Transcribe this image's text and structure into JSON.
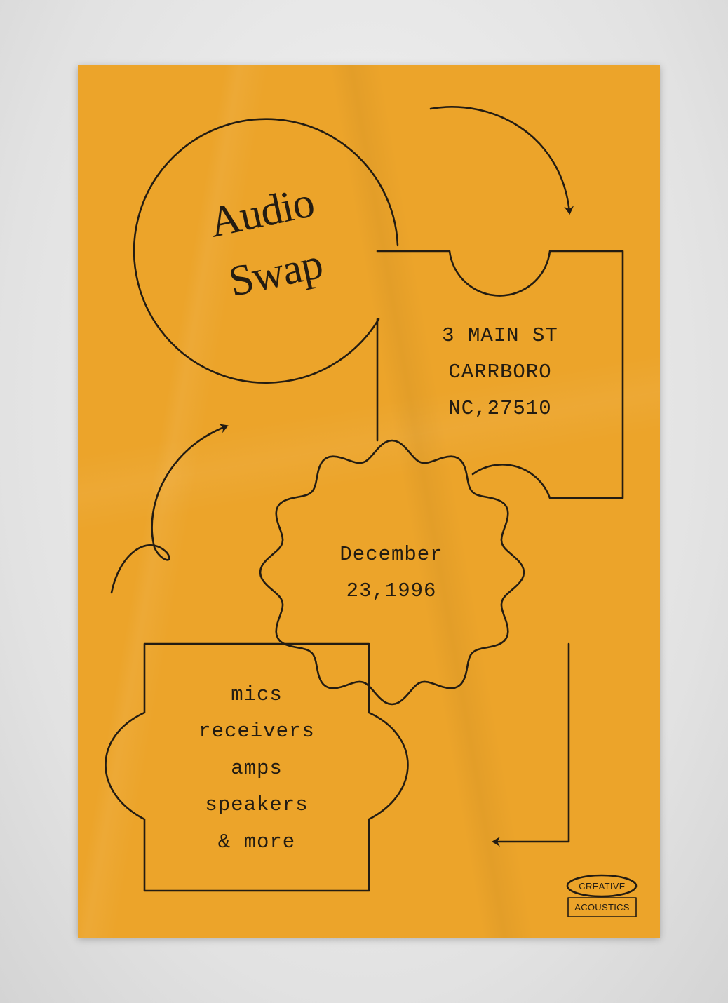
{
  "poster": {
    "title_line1": "Audio",
    "title_line2": "Swap",
    "address": {
      "line1": "3 MAIN ST",
      "line2": "CARRBORO",
      "line3": "NC,27510"
    },
    "date": {
      "line1": "December",
      "line2": "23,1996"
    },
    "items": [
      "mics",
      "receivers",
      "amps",
      "speakers",
      "& more"
    ],
    "logo": {
      "top": "CREATIVE",
      "bottom": "ACOUSTICS"
    },
    "colors": {
      "background": "#eca42a",
      "ink": "#231c12"
    }
  }
}
